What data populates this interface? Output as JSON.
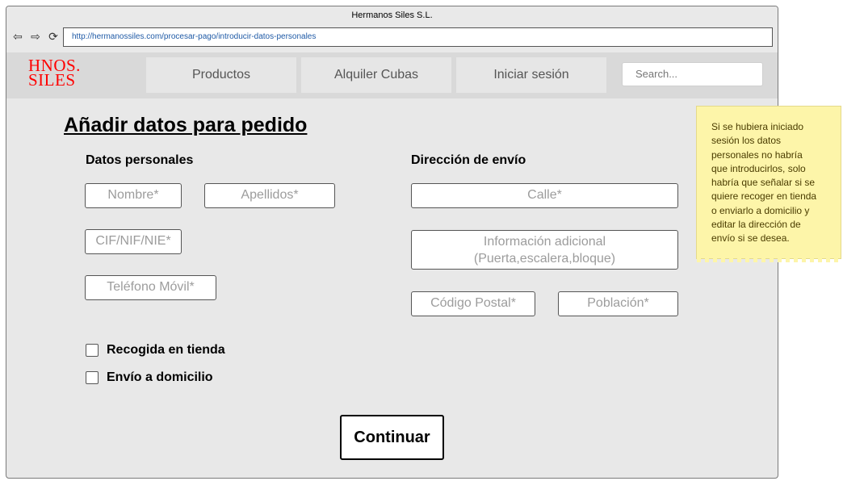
{
  "window": {
    "title": "Hermanos Siles S.L.",
    "url": "http://hermanossiles.com/procesar-pago/introducir-datos-personales",
    "nav_icons": [
      "back-arrow-icon",
      "forward-arrow-icon",
      "reload-icon"
    ]
  },
  "header": {
    "logo_line1": "HNOS.",
    "logo_line2": "SILES",
    "menu": [
      "Productos",
      "Alquiler Cubas",
      "Iniciar sesión"
    ],
    "search_placeholder": "Search..."
  },
  "page": {
    "title": "Añadir datos para pedido",
    "personal": {
      "title": "Datos personales",
      "nombre": "Nombre*",
      "apellidos": "Apellidos*",
      "cif": "CIF/NIF/NIE*",
      "telefono": "Teléfono Móvil*"
    },
    "address": {
      "title": "Dirección de envío",
      "calle": "Calle*",
      "info_line1": "Información adicional",
      "info_line2": "(Puerta,escalera,bloque)",
      "cp": "Código Postal*",
      "poblacion": "Población*"
    },
    "options": {
      "recogida": "Recogida en tienda",
      "envio": "Envío a domicilio"
    },
    "continue_label": "Continuar"
  },
  "note": {
    "lines": [
      "Si se hubiera iniciado",
      "sesión los datos",
      "personales no habría",
      "que introducirlos, solo",
      "habría que señalar si se",
      "quiere recoger en tienda",
      "o enviarlo a domicilio y",
      "editar la dirección de",
      "envío si se desea."
    ]
  },
  "colors": {
    "logo": "#ff0000",
    "note_bg": "#fdf5a9",
    "url_text": "#1f5aa6"
  }
}
